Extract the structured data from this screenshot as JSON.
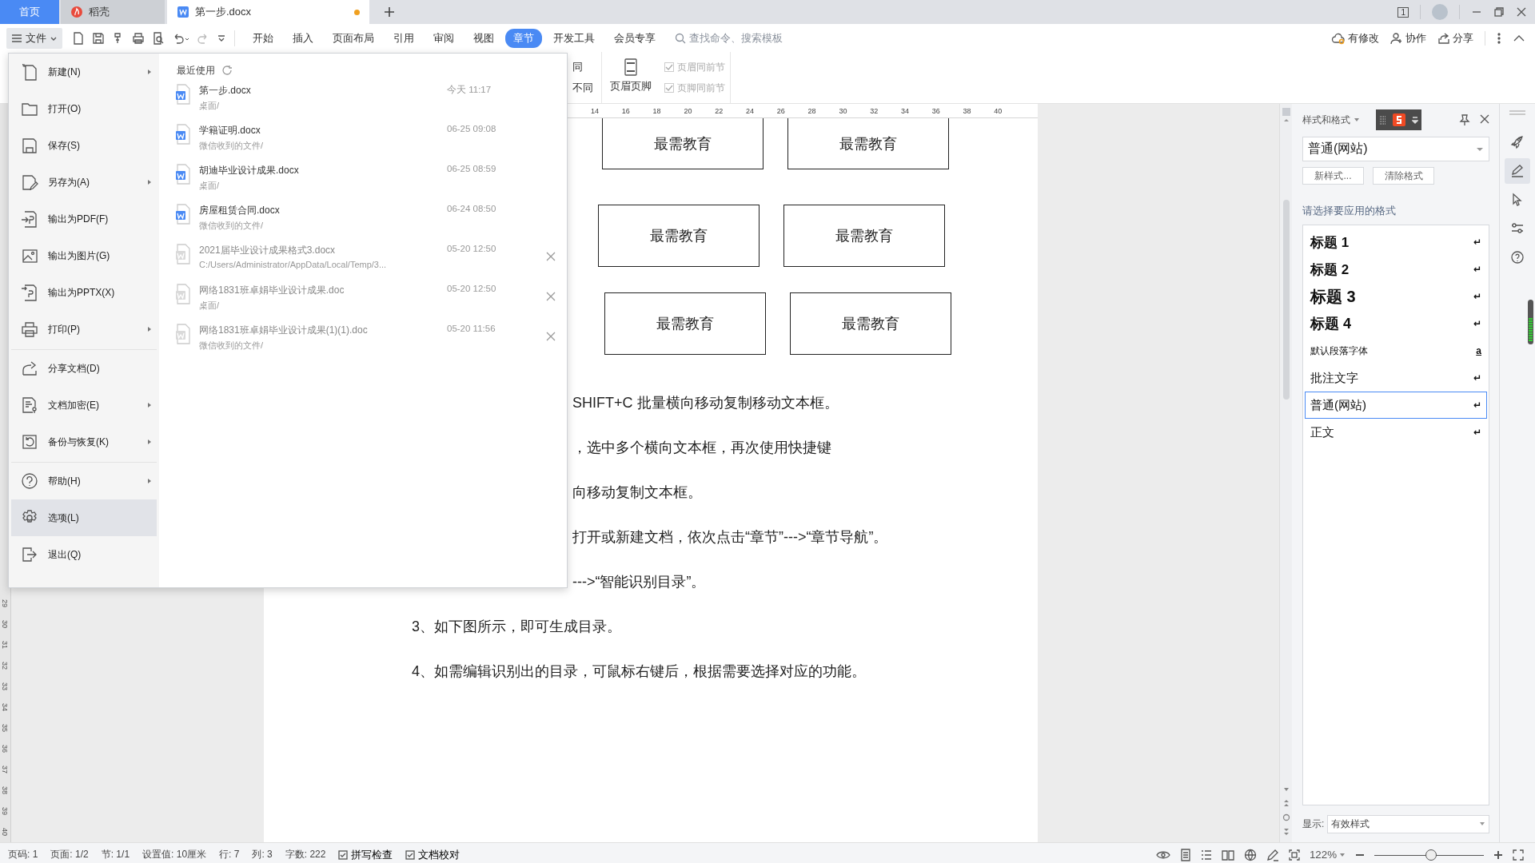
{
  "window_tabs": [
    {
      "label": "首页",
      "kind": "home",
      "selected": false,
      "modified": false
    },
    {
      "label": "稻壳",
      "kind": "app",
      "selected": false,
      "modified": false
    },
    {
      "label": "第一步.docx",
      "kind": "document",
      "selected": true,
      "modified": true
    }
  ],
  "title_bar": {
    "window_count": "1"
  },
  "menu_button": {
    "label": "文件"
  },
  "ribbon_tabs": [
    {
      "label": "开始",
      "selected": false
    },
    {
      "label": "插入",
      "selected": false
    },
    {
      "label": "页面布局",
      "selected": false
    },
    {
      "label": "引用",
      "selected": false
    },
    {
      "label": "审阅",
      "selected": false
    },
    {
      "label": "视图",
      "selected": false
    },
    {
      "label": "章节",
      "selected": true
    },
    {
      "label": "开发工具",
      "selected": false
    },
    {
      "label": "会员专享",
      "selected": false
    }
  ],
  "search": {
    "placeholder": "查找命令、搜索模板"
  },
  "toolbar_actions": [
    {
      "label": "有修改",
      "kind": "cloud"
    },
    {
      "label": "协作",
      "kind": "people"
    },
    {
      "label": "分享",
      "kind": "share"
    }
  ],
  "ribbon": {
    "fragments": [
      "同",
      "不同"
    ],
    "header_footer_button": "页眉页脚",
    "options": [
      {
        "label": "页眉同前节",
        "checked": true,
        "disabled": true
      },
      {
        "label": "页脚同前节",
        "checked": true,
        "disabled": true
      }
    ]
  },
  "file_menu": {
    "groups": [
      [
        {
          "label": "新建(N)",
          "kind": "new",
          "submenu": true,
          "selected": false
        },
        {
          "label": "打开(O)",
          "kind": "open",
          "submenu": false,
          "selected": false
        },
        {
          "label": "保存(S)",
          "kind": "save",
          "submenu": false,
          "selected": false
        },
        {
          "label": "另存为(A)",
          "kind": "saveas",
          "submenu": true,
          "selected": false
        },
        {
          "label": "输出为PDF(F)",
          "kind": "pdf",
          "submenu": false,
          "selected": false
        },
        {
          "label": "输出为图片(G)",
          "kind": "image",
          "submenu": false,
          "selected": false
        },
        {
          "label": "输出为PPTX(X)",
          "kind": "pptx",
          "submenu": false,
          "selected": false
        },
        {
          "label": "打印(P)",
          "kind": "print",
          "submenu": true,
          "selected": false
        }
      ],
      [
        {
          "label": "分享文档(D)",
          "kind": "share",
          "submenu": false,
          "selected": false
        },
        {
          "label": "文档加密(E)",
          "kind": "encrypt",
          "submenu": true,
          "selected": false
        },
        {
          "label": "备份与恢复(K)",
          "kind": "backup",
          "submenu": true,
          "selected": false
        }
      ],
      [
        {
          "label": "帮助(H)",
          "kind": "help",
          "submenu": true,
          "selected": false
        },
        {
          "label": "选项(L)",
          "kind": "options",
          "submenu": false,
          "selected": true
        },
        {
          "label": "退出(Q)",
          "kind": "exit",
          "submenu": false,
          "selected": false
        }
      ]
    ],
    "recent": {
      "title": "最近使用",
      "files": [
        {
          "name": "第一步.docx",
          "path": "桌面/",
          "time": "今天 11:17",
          "available": true
        },
        {
          "name": "学籍证明.docx",
          "path": "微信收到的文件/",
          "time": "06-25 09:08",
          "available": true
        },
        {
          "name": "胡迪毕业设计成果.docx",
          "path": "桌面/",
          "time": "06-25 08:59",
          "available": true
        },
        {
          "name": "房屋租赁合同.docx",
          "path": "微信收到的文件/",
          "time": "06-24 08:50",
          "available": true
        },
        {
          "name": "2021届毕业设计成果格式3.docx",
          "path": "C:/Users/Administrator/AppData/Local/Temp/3...",
          "time": "05-20 12:50",
          "available": false
        },
        {
          "name": "网络1831班卓娟毕业设计成果.doc",
          "path": "桌面/",
          "time": "05-20 12:50",
          "available": false
        },
        {
          "name": "网络1831班卓娟毕业设计成果(1)(1).doc",
          "path": "微信收到的文件/",
          "time": "05-20 11:56",
          "available": false
        }
      ]
    }
  },
  "ruler": {
    "numbers": [
      "14",
      "16",
      "18",
      "20",
      "22",
      "24",
      "26",
      "28",
      "30",
      "32",
      "34",
      "36",
      "38",
      "40"
    ]
  },
  "vertical_ruler": {
    "numbers": [
      "29",
      "30",
      "31",
      "32",
      "33",
      "34",
      "35",
      "36",
      "37",
      "38",
      "39",
      "40"
    ]
  },
  "document": {
    "text_boxes": [
      [
        "最需教育",
        "最需教育"
      ],
      [
        "最需教育",
        "最需教育"
      ],
      [
        "最需教育",
        "最需教育"
      ]
    ],
    "lines_beside_menu": [
      "SHIFT+C 批量横向移动复制移动文本框。",
      "，选中多个横向文本框，再次使用快捷键",
      "向移动复制文本框。",
      "打开或新建文档，依次点击“章节”--->“章节导航”。",
      "--->“智能识别目录”。"
    ],
    "lines": [
      "3、如下图所示，即可生成目录。",
      "4、如需编辑识别出的目录，可鼠标右键后，根据需要选择对应的功能。"
    ]
  },
  "style_pane": {
    "title": "样式和格式",
    "current": "普通(网站)",
    "buttons": [
      "新样式...",
      "清除格式"
    ],
    "prompt": "请选择要应用的格式",
    "styles": [
      {
        "label": "标题 1",
        "kind": "heading1",
        "mark": "↵",
        "selected": false
      },
      {
        "label": "标题 2",
        "kind": "heading2",
        "mark": "↵",
        "selected": false
      },
      {
        "label": "标题 3",
        "kind": "heading3",
        "mark": "↵",
        "selected": false
      },
      {
        "label": "标题 4",
        "kind": "heading4",
        "mark": "↵",
        "selected": false
      },
      {
        "label": "默认段落字体",
        "kind": "character",
        "mark": "a",
        "selected": false
      },
      {
        "label": "批注文字",
        "kind": "paragraph",
        "mark": "↵",
        "selected": false
      },
      {
        "label": "普通(网站)",
        "kind": "paragraph",
        "mark": "↵",
        "selected": true
      },
      {
        "label": "正文",
        "kind": "paragraph",
        "mark": "↵",
        "selected": false
      }
    ],
    "show_label": "显示:",
    "show_value": "有效样式"
  },
  "sidebar": {
    "tools": [
      {
        "kind": "rocket",
        "selected": false
      },
      {
        "kind": "pen",
        "selected": true
      },
      {
        "kind": "cursor",
        "selected": false
      },
      {
        "kind": "sliders",
        "selected": false
      },
      {
        "kind": "help",
        "selected": false
      }
    ]
  },
  "status_bar": {
    "items": [
      "页码: 1",
      "页面: 1/2",
      "节: 1/1",
      "设置值: 10厘米",
      "行: 7",
      "列: 3",
      "字数: 222"
    ],
    "checks": [
      {
        "label": "拼写检查"
      },
      {
        "label": "文档校对"
      }
    ],
    "zoom": "122%",
    "zoom_slider": {
      "level": 0.52
    }
  }
}
